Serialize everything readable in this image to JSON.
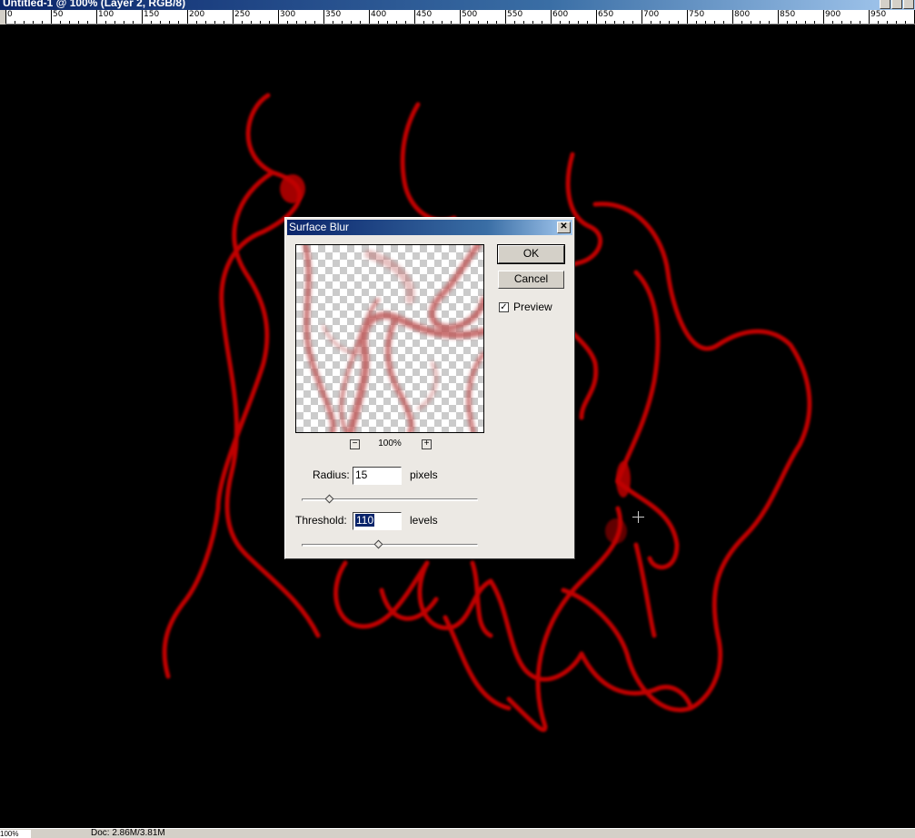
{
  "window": {
    "title": "Untitled-1 @ 100% (Layer 2, RGB/8)"
  },
  "ruler": {
    "labels": [
      "0",
      "50",
      "100",
      "150",
      "200",
      "250",
      "300",
      "350",
      "400",
      "450",
      "500",
      "550",
      "600",
      "650",
      "700",
      "750",
      "800",
      "850",
      "900",
      "950"
    ]
  },
  "statusbar": {
    "zoom": "100%",
    "doc": "Doc: 2.86M/3.81M"
  },
  "dialog": {
    "title": "Surface Blur",
    "close_glyph": "✕",
    "ok_label": "OK",
    "cancel_label": "Cancel",
    "preview_label": "Preview",
    "preview_checked": "✓",
    "zoom_minus": "−",
    "zoom_plus": "+",
    "zoom_level": "100%",
    "radius": {
      "label": "Radius:",
      "value": "15",
      "unit": "pixels",
      "slider_fraction": 0.15
    },
    "threshold": {
      "label": "Threshold:",
      "value": "110",
      "unit": "levels",
      "slider_fraction": 0.43
    }
  },
  "colors": {
    "stroke": "#c00000",
    "stroke_soft": "#d07070",
    "title_bar": "#0a246a"
  }
}
